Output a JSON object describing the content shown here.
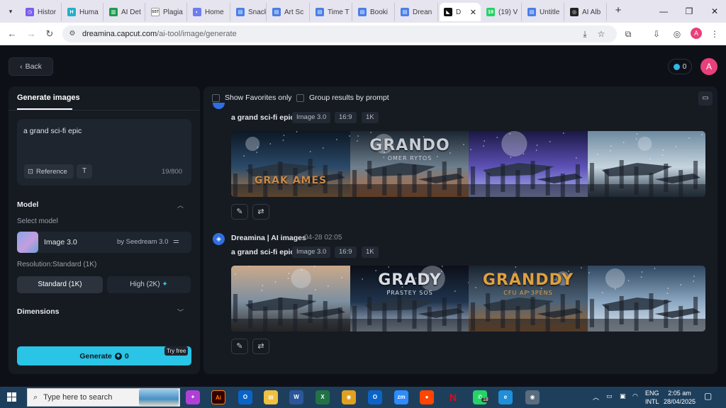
{
  "browser": {
    "tabs": [
      {
        "label": "Histor",
        "fav_color": "#7a5cf0",
        "fav_glyph": "◷"
      },
      {
        "label": "Huma",
        "fav_color": "#21b0c9",
        "fav_glyph": "H"
      },
      {
        "label": "AI Det",
        "fav_color": "#1e9b4f",
        "fav_glyph": "▥"
      },
      {
        "label": "Plagia",
        "fav_color": "#ffffff",
        "fav_glyph": "SST"
      },
      {
        "label": "Home",
        "fav_color": "#6b7df0",
        "fav_glyph": "◐"
      },
      {
        "label": "Snack",
        "fav_color": "#4a7fe6",
        "fav_glyph": "▤"
      },
      {
        "label": "Art Sc",
        "fav_color": "#4a7fe6",
        "fav_glyph": "▤"
      },
      {
        "label": "Time T",
        "fav_color": "#4a7fe6",
        "fav_glyph": "▤"
      },
      {
        "label": "Booki",
        "fav_color": "#4a7fe6",
        "fav_glyph": "▤"
      },
      {
        "label": "Drean",
        "fav_color": "#4a7fe6",
        "fav_glyph": "▤"
      },
      {
        "label": "D",
        "fav_color": "#111111",
        "fav_glyph": "◣"
      },
      {
        "label": "(19) V",
        "fav_color": "#25d366",
        "fav_glyph": "19"
      },
      {
        "label": "Untitle",
        "fav_color": "#4a7fe6",
        "fav_glyph": "▤"
      },
      {
        "label": "AI Alb",
        "fav_color": "#222222",
        "fav_glyph": "◎"
      }
    ],
    "url_host": "dreamina.capcut.com",
    "url_path": "/ai-tool/image/generate",
    "profile_initial": "A"
  },
  "header": {
    "back_label": "Back",
    "credits": "0",
    "avatar_initial": "A"
  },
  "left": {
    "tab_label": "Generate images",
    "prompt": "a grand sci-fi epic",
    "reference_label": "Reference",
    "text_btn": "T",
    "char_count": "19/800",
    "model_title": "Model",
    "select_model": "Select model",
    "model_name": "Image 3.0",
    "model_by": "by Seedream 3.0",
    "resolution_label": "Resolution:Standard (1K)",
    "res_standard": "Standard (1K)",
    "res_high": "High (2K)",
    "dimensions_title": "Dimensions",
    "generate_label": "Generate",
    "generate_cost": "0",
    "try_free": "Try free"
  },
  "right": {
    "show_favorites": "Show Favorites only",
    "group_results": "Group results by prompt",
    "groups": [
      {
        "author": "",
        "time": "",
        "prompt": "a grand sci-fi epic",
        "tags": [
          "Image 3.0",
          "16:9",
          "1K"
        ],
        "images": [
          {
            "overlay": "GRAK AMES",
            "overlay_color": "#c98a4a"
          },
          {
            "overlay": "GRANDO",
            "overlay_sub": "OMER RYTOS",
            "overlay_color": "#c8ccd4"
          },
          {
            "overlay": "",
            "overlay_color": ""
          },
          {
            "overlay": "",
            "overlay_color": ""
          }
        ]
      },
      {
        "author": "Dreamina | AI images",
        "time": "04-28  02:05",
        "prompt": "a grand sci-fi epic",
        "tags": [
          "Image 3.0",
          "16:9",
          "1K"
        ],
        "images": [
          {
            "overlay": "",
            "overlay_color": ""
          },
          {
            "overlay": "GRADY",
            "overlay_sub": "PRASTEY SOS",
            "overlay_color": "#d8dce2"
          },
          {
            "overlay": "GRANDDY",
            "overlay_sub": "CFU AP 3PENS",
            "overlay_color": "#e0a040"
          },
          {
            "overlay": "",
            "overlay_color": ""
          }
        ]
      }
    ]
  },
  "taskbar": {
    "search_placeholder": "Type here to search",
    "whatsapp_badge": "18",
    "lang_top": "ENG",
    "lang_bottom": "INTL",
    "time": "2:05 am",
    "date": "28/04/2025"
  }
}
